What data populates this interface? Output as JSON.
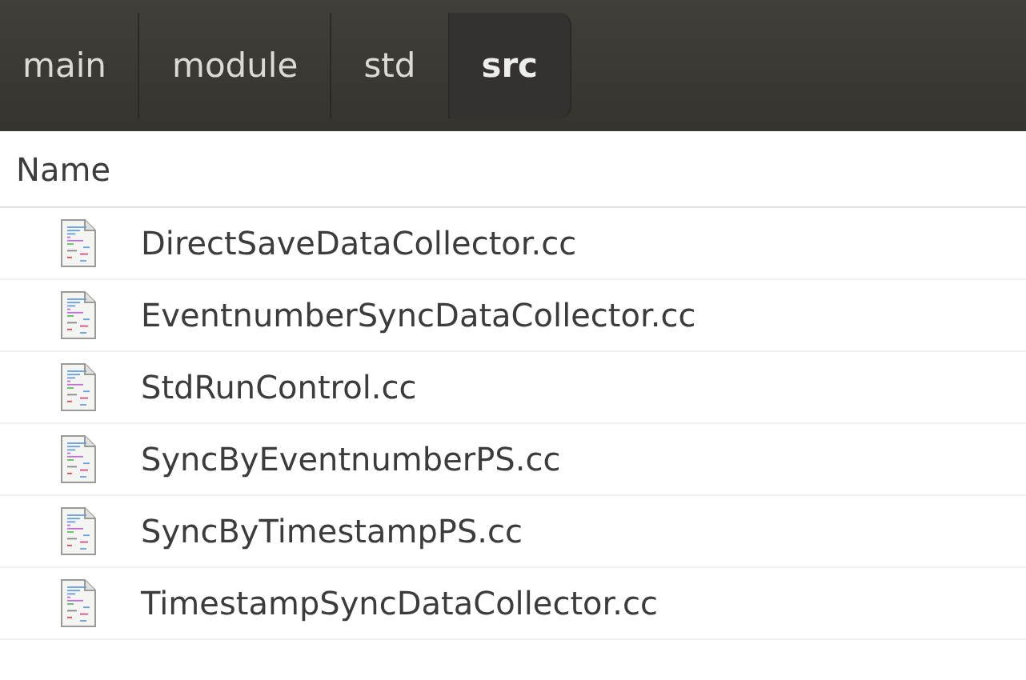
{
  "breadcrumbs": [
    {
      "label": "main",
      "selected": false
    },
    {
      "label": "module",
      "selected": false
    },
    {
      "label": "std",
      "selected": false
    },
    {
      "label": "src",
      "selected": true
    }
  ],
  "columns": [
    "Name"
  ],
  "files": [
    {
      "name": "DirectSaveDataCollector.cc"
    },
    {
      "name": "EventnumberSyncDataCollector.cc"
    },
    {
      "name": "StdRunControl.cc"
    },
    {
      "name": "SyncByEventnumberPS.cc"
    },
    {
      "name": "SyncByTimestampPS.cc"
    },
    {
      "name": "TimestampSyncDataCollector.cc"
    }
  ]
}
